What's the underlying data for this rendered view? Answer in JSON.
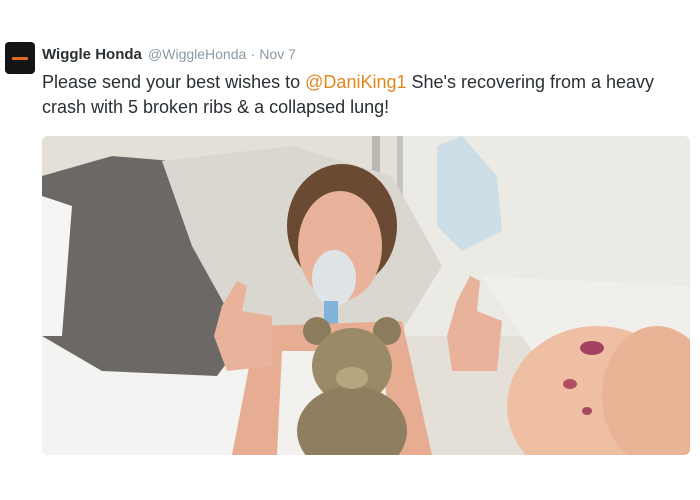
{
  "tweet": {
    "author_name": "Wiggle Honda",
    "author_handle": "@WiggleHonda",
    "separator": "·",
    "timestamp": "Nov 7",
    "text_before_mention": "Please send your best wishes to ",
    "mention": "@DaniKing1",
    "text_after_mention": " She's recovering from a heavy crash with 5 broken ribs & a collapsed lung!",
    "avatar_icon": "team-logo-icon",
    "mention_color": "#e1871e",
    "name_color": "#292f33",
    "meta_color": "#8899a6"
  },
  "media": {
    "icon": "tweet-photo"
  }
}
